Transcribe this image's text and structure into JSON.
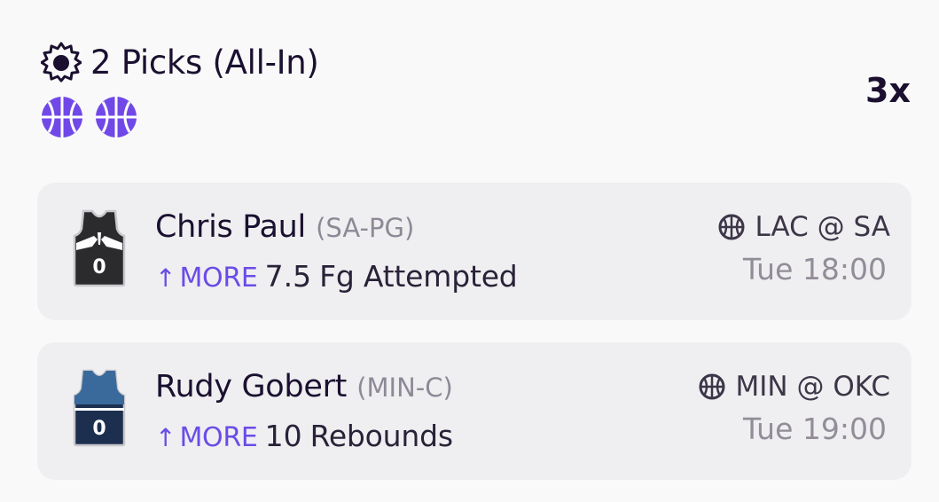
{
  "header": {
    "title": "2 Picks (All-In)",
    "multiplier": "3x",
    "icon": "sun-gear-icon",
    "sport_icons": [
      "basketball-icon",
      "basketball-icon"
    ]
  },
  "colors": {
    "accent": "#6b4ce6",
    "text": "#1b1030",
    "muted": "#8e8996",
    "card": "#efeff1"
  },
  "picks": [
    {
      "name": "Chris Paul",
      "pos": "(SA-PG)",
      "direction": "MORE",
      "line": "7.5",
      "stat": "Fg Attempted",
      "matchup": "LAC @ SA",
      "time": "Tue 18:00",
      "jersey_number": "0",
      "jersey_team": "SA"
    },
    {
      "name": "Rudy Gobert",
      "pos": "(MIN-C)",
      "direction": "MORE",
      "line": "10",
      "stat": "Rebounds",
      "matchup": "MIN @ OKC",
      "time": "Tue 19:00",
      "jersey_number": "0",
      "jersey_team": "MIN"
    }
  ]
}
